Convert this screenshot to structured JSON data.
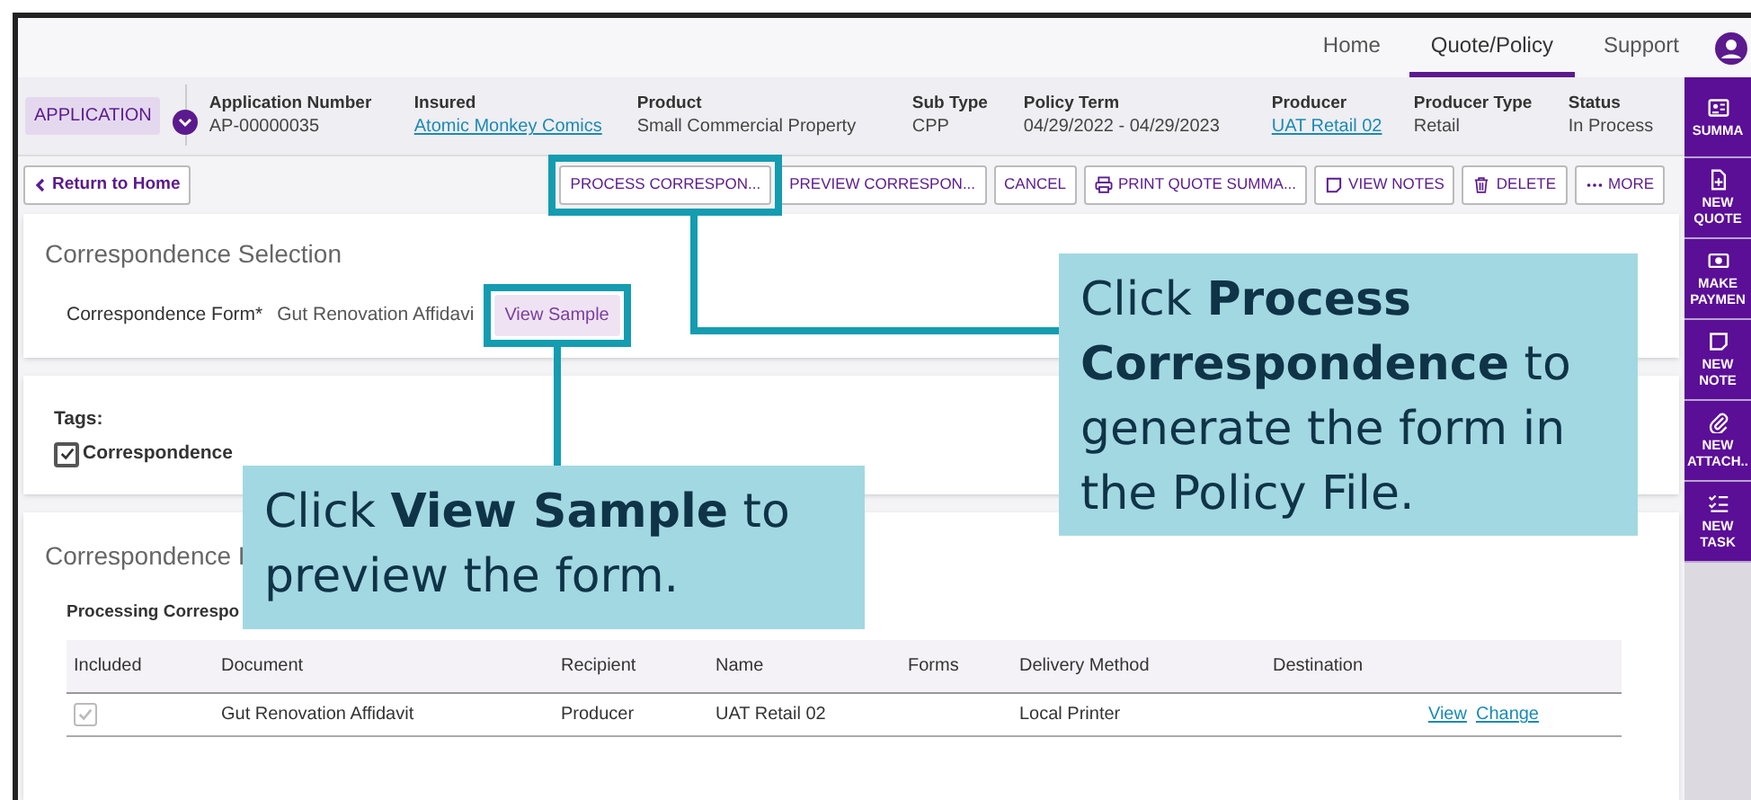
{
  "top_nav": [
    {
      "label": "Home",
      "selected": false
    },
    {
      "label": "Quote/Policy",
      "selected": true
    },
    {
      "label": "Support",
      "selected": false
    }
  ],
  "header": {
    "badge": "APPLICATION",
    "fields": [
      {
        "label": "Application Number",
        "value": "AP-00000035",
        "link": false
      },
      {
        "label": "Insured",
        "value": "Atomic Monkey Comics",
        "link": true
      },
      {
        "label": "Product",
        "value": "Small Commercial Property",
        "link": false
      },
      {
        "label": "Sub Type",
        "value": "CPP",
        "link": false
      },
      {
        "label": "Policy Term",
        "value": "04/29/2022 - 04/29/2023",
        "link": false
      },
      {
        "label": "Producer",
        "value": "UAT Retail 02",
        "link": true
      },
      {
        "label": "Producer Type",
        "value": "Retail",
        "link": false
      },
      {
        "label": "Status",
        "value": "In Process",
        "link": false
      }
    ]
  },
  "back_button": "Return to Home",
  "actions": [
    "PROCESS CORRESPON...",
    "PREVIEW CORRESPON...",
    "CANCEL",
    "PRINT QUOTE SUMMA...",
    "VIEW NOTES",
    "DELETE",
    "MORE"
  ],
  "sidebar": [
    "SUMMA",
    "NEW QUOTE",
    "MAKE PAYMEN",
    "NEW NOTE",
    "NEW ATTACH..",
    "NEW TASK"
  ],
  "selection": {
    "title": "Correspondence Selection",
    "form_label": "Correspondence Form*",
    "form_value": "Gut Renovation Affidavi",
    "sample_button": "View Sample"
  },
  "tags": {
    "label": "Tags:",
    "items": [
      {
        "label": "Correspondence",
        "checked": true
      }
    ]
  },
  "processing": {
    "title": "Correspondence I",
    "subtitle": "Processing Correspo",
    "columns": [
      "Included",
      "Document",
      "Recipient",
      "Name",
      "Forms",
      "Delivery Method",
      "Destination"
    ],
    "rows": [
      {
        "included": true,
        "document": "Gut Renovation Affidavit",
        "recipient": "Producer",
        "name": "UAT Retail 02",
        "delivery_method": "Local Printer",
        "links": [
          "View",
          "Change"
        ]
      }
    ]
  },
  "callouts": [
    {
      "text": "Click **Process Correspondence** to generate the form in the Policy File."
    },
    {
      "text": "Click **View Sample** to preview the form."
    }
  ]
}
